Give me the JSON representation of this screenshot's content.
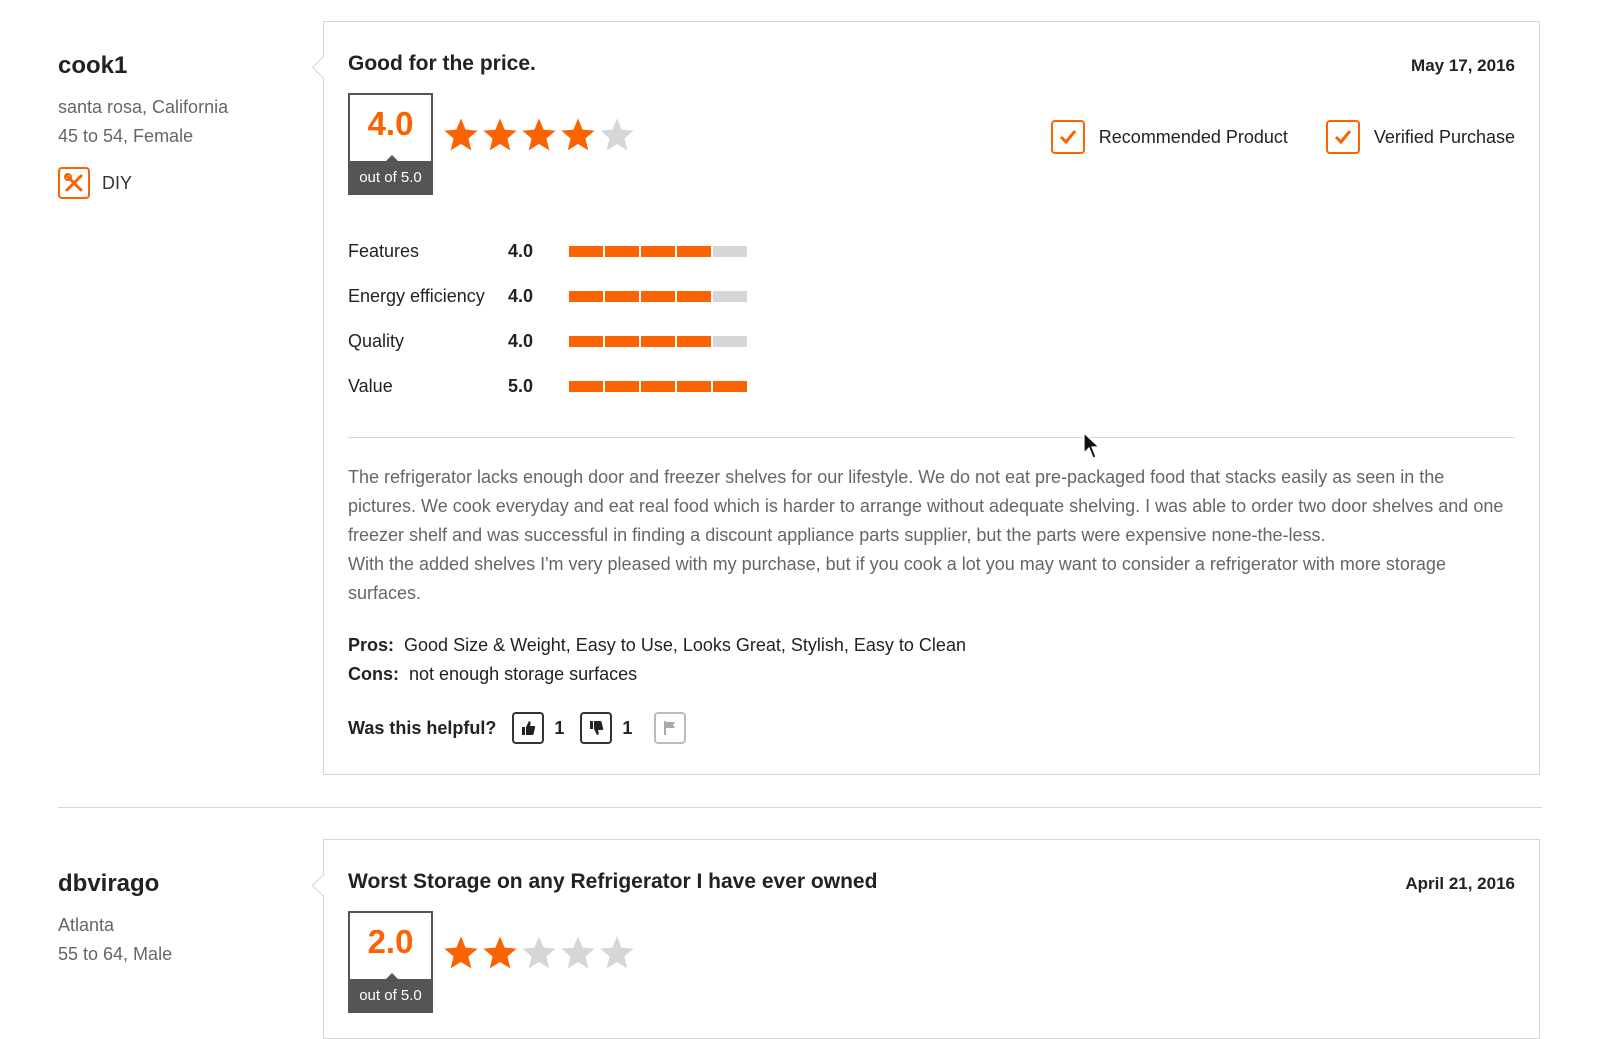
{
  "reviews": [
    {
      "user": {
        "name": "cook1",
        "location": "santa rosa, California",
        "demographic": "45 to 54, Female",
        "badge": "DIY",
        "badge_icon": "tools-icon"
      },
      "title": "Good for the price.",
      "date": "May 17, 2016",
      "rating": {
        "value": "4.0",
        "out_of": "out of 5.0",
        "stars": 4
      },
      "checks": {
        "recommended": "Recommended Product",
        "verified": "Verified Purchase"
      },
      "sub_ratings": [
        {
          "label": "Features",
          "value": "4.0",
          "score": 4
        },
        {
          "label": "Energy efficiency",
          "value": "4.0",
          "score": 4
        },
        {
          "label": "Quality",
          "value": "4.0",
          "score": 4
        },
        {
          "label": "Value",
          "value": "5.0",
          "score": 5
        }
      ],
      "body_line1": "The refrigerator lacks enough door and freezer shelves for our lifestyle. We do not eat pre-packaged food that stacks easily as seen in the pictures. We cook everyday and eat real food which is harder to arrange without adequate shelving. I was able to order two door shelves and one freezer shelf and was successful in finding a discount appliance parts supplier, but the parts were expensive none-the-less.",
      "body_line2": "With the added shelves I'm very pleased with my purchase, but if you cook a lot you may want to consider a refrigerator with more storage surfaces.",
      "pros_label": "Pros:",
      "pros": "Good Size & Weight, Easy to Use, Looks Great, Stylish, Easy to Clean",
      "cons_label": "Cons:",
      "cons": "not enough storage surfaces",
      "helpful": {
        "label": "Was this helpful?",
        "up": "1",
        "down": "1"
      }
    },
    {
      "user": {
        "name": "dbvirago",
        "location": "Atlanta",
        "demographic": "55 to 64, Male"
      },
      "title": "Worst Storage on any Refrigerator I have ever owned",
      "date": "April 21, 2016",
      "rating": {
        "value": "2.0",
        "out_of": "out of 5.0",
        "stars": 2
      }
    }
  ],
  "colors": {
    "accent": "#f96302",
    "star_off": "#d6d6d6"
  }
}
